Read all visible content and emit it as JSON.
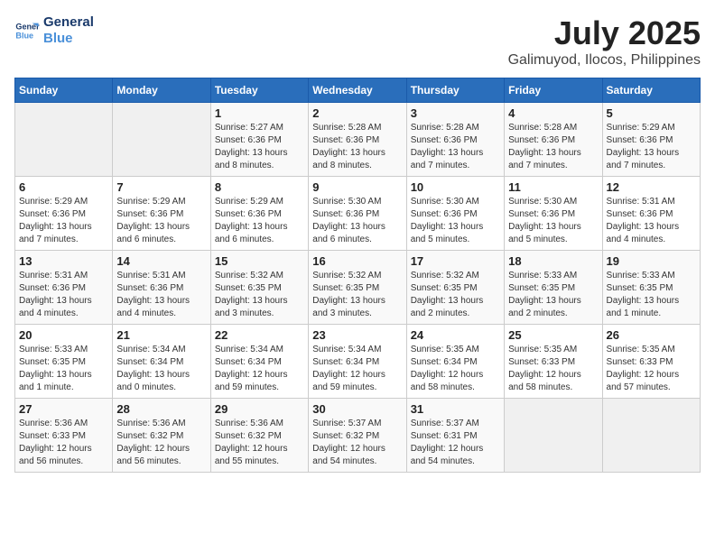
{
  "logo": {
    "line1": "General",
    "line2": "Blue"
  },
  "title": "July 2025",
  "subtitle": "Galimuyod, Ilocos, Philippines",
  "days_of_week": [
    "Sunday",
    "Monday",
    "Tuesday",
    "Wednesday",
    "Thursday",
    "Friday",
    "Saturday"
  ],
  "weeks": [
    [
      {
        "day": null
      },
      {
        "day": null
      },
      {
        "day": 1,
        "sunrise": "5:27 AM",
        "sunset": "6:36 PM",
        "daylight": "13 hours and 8 minutes."
      },
      {
        "day": 2,
        "sunrise": "5:28 AM",
        "sunset": "6:36 PM",
        "daylight": "13 hours and 8 minutes."
      },
      {
        "day": 3,
        "sunrise": "5:28 AM",
        "sunset": "6:36 PM",
        "daylight": "13 hours and 7 minutes."
      },
      {
        "day": 4,
        "sunrise": "5:28 AM",
        "sunset": "6:36 PM",
        "daylight": "13 hours and 7 minutes."
      },
      {
        "day": 5,
        "sunrise": "5:29 AM",
        "sunset": "6:36 PM",
        "daylight": "13 hours and 7 minutes."
      }
    ],
    [
      {
        "day": 6,
        "sunrise": "5:29 AM",
        "sunset": "6:36 PM",
        "daylight": "13 hours and 7 minutes."
      },
      {
        "day": 7,
        "sunrise": "5:29 AM",
        "sunset": "6:36 PM",
        "daylight": "13 hours and 6 minutes."
      },
      {
        "day": 8,
        "sunrise": "5:29 AM",
        "sunset": "6:36 PM",
        "daylight": "13 hours and 6 minutes."
      },
      {
        "day": 9,
        "sunrise": "5:30 AM",
        "sunset": "6:36 PM",
        "daylight": "13 hours and 6 minutes."
      },
      {
        "day": 10,
        "sunrise": "5:30 AM",
        "sunset": "6:36 PM",
        "daylight": "13 hours and 5 minutes."
      },
      {
        "day": 11,
        "sunrise": "5:30 AM",
        "sunset": "6:36 PM",
        "daylight": "13 hours and 5 minutes."
      },
      {
        "day": 12,
        "sunrise": "5:31 AM",
        "sunset": "6:36 PM",
        "daylight": "13 hours and 4 minutes."
      }
    ],
    [
      {
        "day": 13,
        "sunrise": "5:31 AM",
        "sunset": "6:36 PM",
        "daylight": "13 hours and 4 minutes."
      },
      {
        "day": 14,
        "sunrise": "5:31 AM",
        "sunset": "6:36 PM",
        "daylight": "13 hours and 4 minutes."
      },
      {
        "day": 15,
        "sunrise": "5:32 AM",
        "sunset": "6:35 PM",
        "daylight": "13 hours and 3 minutes."
      },
      {
        "day": 16,
        "sunrise": "5:32 AM",
        "sunset": "6:35 PM",
        "daylight": "13 hours and 3 minutes."
      },
      {
        "day": 17,
        "sunrise": "5:32 AM",
        "sunset": "6:35 PM",
        "daylight": "13 hours and 2 minutes."
      },
      {
        "day": 18,
        "sunrise": "5:33 AM",
        "sunset": "6:35 PM",
        "daylight": "13 hours and 2 minutes."
      },
      {
        "day": 19,
        "sunrise": "5:33 AM",
        "sunset": "6:35 PM",
        "daylight": "13 hours and 1 minute."
      }
    ],
    [
      {
        "day": 20,
        "sunrise": "5:33 AM",
        "sunset": "6:35 PM",
        "daylight": "13 hours and 1 minute."
      },
      {
        "day": 21,
        "sunrise": "5:34 AM",
        "sunset": "6:34 PM",
        "daylight": "13 hours and 0 minutes."
      },
      {
        "day": 22,
        "sunrise": "5:34 AM",
        "sunset": "6:34 PM",
        "daylight": "12 hours and 59 minutes."
      },
      {
        "day": 23,
        "sunrise": "5:34 AM",
        "sunset": "6:34 PM",
        "daylight": "12 hours and 59 minutes."
      },
      {
        "day": 24,
        "sunrise": "5:35 AM",
        "sunset": "6:34 PM",
        "daylight": "12 hours and 58 minutes."
      },
      {
        "day": 25,
        "sunrise": "5:35 AM",
        "sunset": "6:33 PM",
        "daylight": "12 hours and 58 minutes."
      },
      {
        "day": 26,
        "sunrise": "5:35 AM",
        "sunset": "6:33 PM",
        "daylight": "12 hours and 57 minutes."
      }
    ],
    [
      {
        "day": 27,
        "sunrise": "5:36 AM",
        "sunset": "6:33 PM",
        "daylight": "12 hours and 56 minutes."
      },
      {
        "day": 28,
        "sunrise": "5:36 AM",
        "sunset": "6:32 PM",
        "daylight": "12 hours and 56 minutes."
      },
      {
        "day": 29,
        "sunrise": "5:36 AM",
        "sunset": "6:32 PM",
        "daylight": "12 hours and 55 minutes."
      },
      {
        "day": 30,
        "sunrise": "5:37 AM",
        "sunset": "6:32 PM",
        "daylight": "12 hours and 54 minutes."
      },
      {
        "day": 31,
        "sunrise": "5:37 AM",
        "sunset": "6:31 PM",
        "daylight": "12 hours and 54 minutes."
      },
      {
        "day": null
      },
      {
        "day": null
      }
    ]
  ]
}
